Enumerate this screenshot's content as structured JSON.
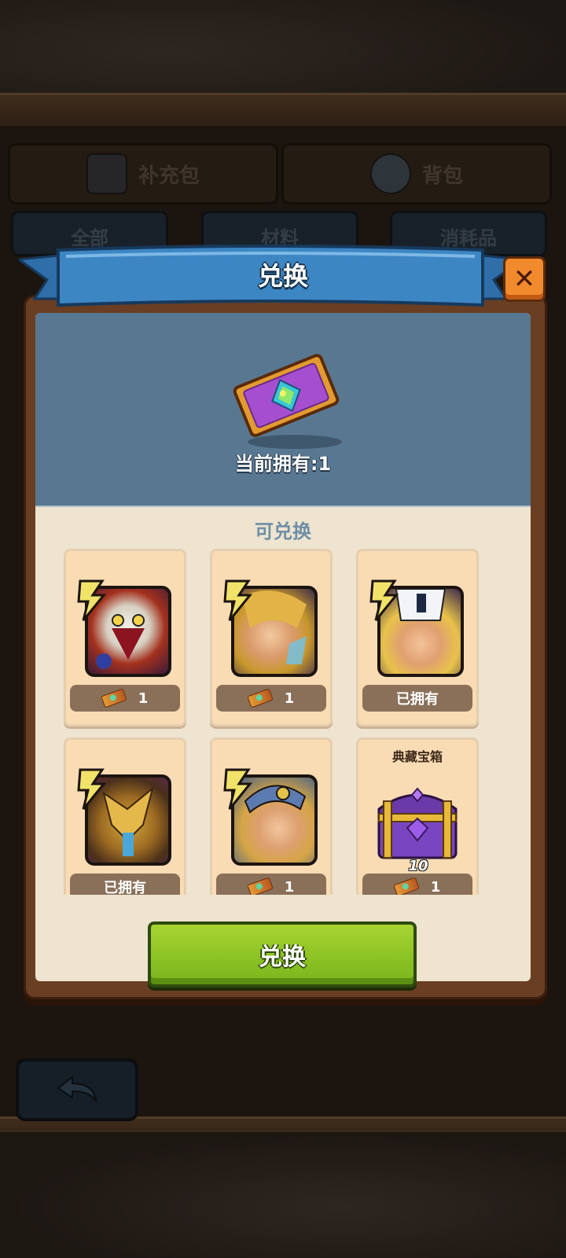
{
  "background": {
    "tabs": [
      {
        "label": "补充包",
        "icon": "card-pack-icon"
      },
      {
        "label": "背包",
        "icon": "bag-icon"
      }
    ],
    "subtabs": [
      "全部",
      "材料",
      "消耗品"
    ],
    "back_icon": "back-arrow-icon"
  },
  "dialog": {
    "title": "兑换",
    "close_icon": "close-icon",
    "owned_label": "当前拥有:1",
    "section_title": "可兑换",
    "confirm_label": "兑换",
    "items": [
      {
        "label": "",
        "portrait": "owl-beast-hero",
        "status": "1",
        "price_icon": "ticket-icon"
      },
      {
        "label": "",
        "portrait": "blonde-mage-hero",
        "status": "1",
        "price_icon": "ticket-icon"
      },
      {
        "label": "",
        "portrait": "white-helm-warrior-hero",
        "status": "已拥有"
      },
      {
        "label": "",
        "portrait": "golden-dragon-hero",
        "status": "已拥有"
      },
      {
        "label": "",
        "portrait": "valkyrie-hero",
        "status": "1",
        "price_icon": "ticket-icon"
      },
      {
        "label": "典藏宝箱",
        "portrait": "treasure-chest",
        "quantity": "10",
        "status": "1",
        "price_icon": "ticket-icon"
      }
    ]
  },
  "colors": {
    "ribbon_blue": "#3d86c4",
    "confirm_green": "#8cc425",
    "close_orange": "#f08a2c",
    "card_bg": "#f9dcb3",
    "header_blue": "#587892"
  }
}
